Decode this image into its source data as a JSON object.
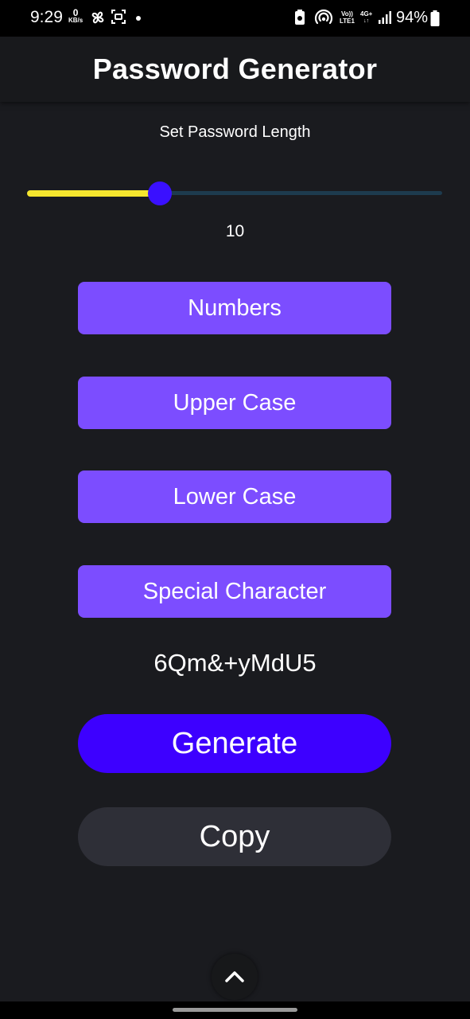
{
  "status_bar": {
    "time": "9:29",
    "net_speed_value": "0",
    "net_speed_unit": "KB/s",
    "volte_top": "Vo))",
    "volte_bottom": "LTE1",
    "network_type": "4G+",
    "battery_percent": "94%"
  },
  "app": {
    "title": "Password Generator"
  },
  "length": {
    "label": "Set Password Length",
    "value": "10",
    "slider_fraction": 0.32
  },
  "options": [
    {
      "label": "Numbers"
    },
    {
      "label": "Upper Case"
    },
    {
      "label": "Lower Case"
    },
    {
      "label": "Special Character"
    }
  ],
  "password": "6Qm&+yMdU5",
  "actions": {
    "generate_label": "Generate",
    "copy_label": "Copy"
  },
  "colors": {
    "background": "#1a1b1f",
    "option_button": "#7c4dff",
    "generate_button": "#3d00ff",
    "copy_button": "#2e2f37",
    "slider_fill": "#f5e62e",
    "slider_thumb": "#3a10ff",
    "slider_track": "#1d3b4e"
  },
  "icons": {
    "scroll_up": "chevron-up-icon"
  }
}
